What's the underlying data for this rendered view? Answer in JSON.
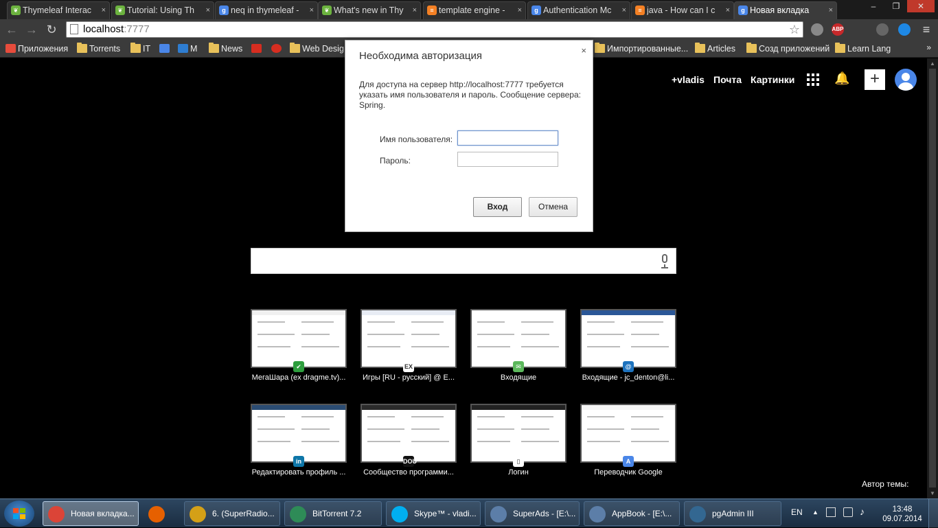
{
  "tabs": [
    {
      "label": "Thymeleaf Interac",
      "icon": "leaf-icon",
      "color": "#6cb33f"
    },
    {
      "label": "Tutorial: Using Th",
      "icon": "leaf-icon",
      "color": "#6cb33f"
    },
    {
      "label": "neq in thymeleaf -",
      "icon": "google-icon",
      "color": "#4a86e8"
    },
    {
      "label": "What's new in Thy",
      "icon": "leaf-icon",
      "color": "#6cb33f"
    },
    {
      "label": "template engine -",
      "icon": "stackoverflow-icon",
      "color": "#f48024"
    },
    {
      "label": "Authentication Mc",
      "icon": "google-icon",
      "color": "#4a86e8"
    },
    {
      "label": "java - How can I c",
      "icon": "stackoverflow-icon",
      "color": "#f48024"
    },
    {
      "label": "Новая вкладка",
      "icon": "google-icon",
      "color": "#4a86e8",
      "active": true
    }
  ],
  "tab_close": "×",
  "window_controls": {
    "minimize": "–",
    "restore": "❐",
    "close": "✕"
  },
  "toolbar": {
    "back": "←",
    "forward": "→",
    "reload": "↻",
    "url_host": "localhost",
    "url_port": ":7777",
    "star": "☆",
    "extensions": [
      {
        "name": "privacy-extension-icon",
        "text": "",
        "color": "#888"
      },
      {
        "name": "adblock-icon",
        "text": "ABP",
        "color": "#c7282a"
      },
      {
        "name": "tools-extension-icon",
        "text": "",
        "color": "#666"
      },
      {
        "name": "translate-extension-icon",
        "text": "",
        "color": "#1e88e5"
      }
    ],
    "menu": "≡"
  },
  "bookmarks": {
    "items": [
      {
        "label": "Приложения",
        "kind": "apps"
      },
      {
        "label": "Torrents",
        "kind": "folder"
      },
      {
        "label": "IT",
        "kind": "folder"
      },
      {
        "label": "",
        "kind": "translate"
      },
      {
        "label": "M",
        "kind": "m"
      },
      {
        "label": "News",
        "kind": "folder"
      },
      {
        "label": "",
        "kind": "t"
      },
      {
        "label": "",
        "kind": "hh"
      },
      {
        "label": "Web Desig",
        "kind": "folder"
      },
      {
        "label": "Импортированные...",
        "kind": "folder"
      },
      {
        "label": "Articles",
        "kind": "folder"
      },
      {
        "label": "Созд приложений",
        "kind": "folder"
      },
      {
        "label": "Learn Lang",
        "kind": "folder"
      }
    ],
    "more": "»"
  },
  "newtab": {
    "top_links": {
      "user": "+vladis",
      "mail": "Почта",
      "images": "Картинки"
    },
    "plus": "+",
    "bell": "🔔",
    "author_label": "Автор темы:",
    "tiles": [
      {
        "label": "МегаШара (ex dragme.tv)...",
        "badge": "✔",
        "badge_color": "#2e9e3e",
        "strip": "#f0f0f0"
      },
      {
        "label": "Игры [RU - русский] @ E...",
        "badge": "EX",
        "badge_color": "#ffffff",
        "strip": "#e8ecf4"
      },
      {
        "label": "Входящие",
        "badge": "✉",
        "badge_color": "#5cb85c",
        "strip": "#ffffff"
      },
      {
        "label": "Входящие - jc_denton@li...",
        "badge": "@",
        "badge_color": "#1e73be",
        "strip": "#2b5797"
      },
      {
        "label": "Редактировать профиль ...",
        "badge": "in",
        "badge_color": "#0e76a8",
        "strip": "#2b4c73"
      },
      {
        "label": "Сообщество программи...",
        "badge": "DOU",
        "badge_color": "#111111",
        "strip": "#2b2b2b"
      },
      {
        "label": "Логин",
        "badge": "▯",
        "badge_color": "#ffffff",
        "strip": "#222222"
      },
      {
        "label": "Переводчик Google",
        "badge": "A",
        "badge_color": "#4a86e8",
        "strip": "#f5f5f5"
      }
    ]
  },
  "dialog": {
    "title": "Необходима авторизация",
    "close": "×",
    "message": "Для доступа на сервер http://localhost:7777 требуется указать имя пользователя и пароль. Сообщение сервера: Spring.",
    "username_label": "Имя пользователя:",
    "password_label": "Пароль:",
    "username_value": "",
    "password_value": "",
    "login_button": "Вход",
    "cancel_button": "Отмена"
  },
  "taskbar": {
    "items": [
      {
        "label": "Новая вкладка...",
        "icon": "chrome-icon",
        "color": "#db4437",
        "active": true,
        "plain": false
      },
      {
        "label": "",
        "icon": "firefox-icon",
        "color": "#e66000",
        "active": false,
        "plain": true
      },
      {
        "label": "6. (SuperRadio...",
        "icon": "winamp-icon",
        "color": "#d4a017",
        "active": false,
        "plain": false
      },
      {
        "label": "BitTorrent 7.2",
        "icon": "bittorrent-icon",
        "color": "#2e8b57",
        "active": false,
        "plain": false
      },
      {
        "label": "Skype™ - vladi...",
        "icon": "skype-icon",
        "color": "#00aff0",
        "active": false,
        "plain": false
      },
      {
        "label": "SuperAds - [E:\\...",
        "icon": "intellij-icon",
        "color": "#5c7ea8",
        "active": false,
        "plain": false
      },
      {
        "label": "AppBook - [E:\\...",
        "icon": "intellij-icon",
        "color": "#5c7ea8",
        "active": false,
        "plain": false
      },
      {
        "label": "pgAdmin III",
        "icon": "pgadmin-icon",
        "color": "#336791",
        "active": false,
        "plain": false
      }
    ],
    "lang": "EN",
    "tray_arrow": "▲",
    "time": "13:48",
    "date": "09.07.2014"
  }
}
